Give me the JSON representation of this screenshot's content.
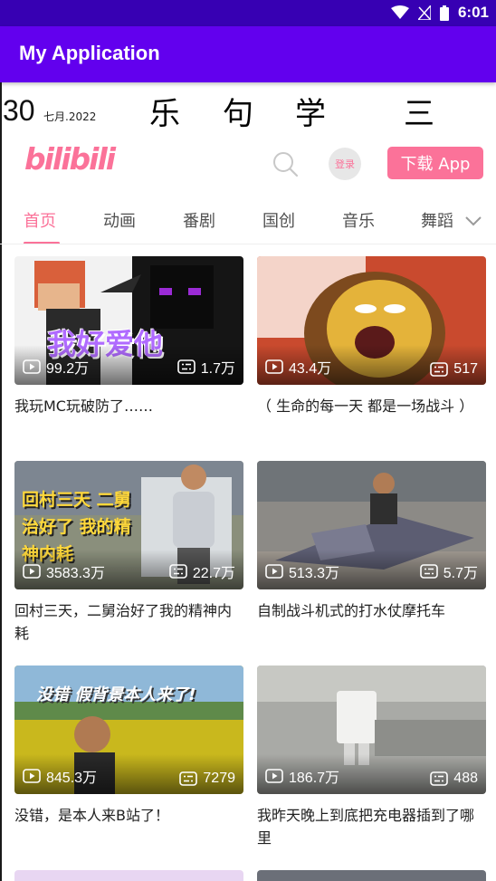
{
  "status_bar": {
    "time": "6:01"
  },
  "app_bar": {
    "title": "My Application"
  },
  "date": {
    "day": "30",
    "month_year": "七月.2022"
  },
  "word": {
    "chars": [
      "乐",
      "句",
      "学",
      "三"
    ]
  },
  "header": {
    "logo": "bilibili",
    "login_label": "登录",
    "download_label": "下载 App"
  },
  "tabs": [
    "首页",
    "动画",
    "番剧",
    "国创",
    "音乐",
    "舞蹈"
  ],
  "videos": [
    {
      "title": "我玩MC玩破防了……",
      "caption": "我好爱他",
      "views": "99.2万",
      "danmaku": "1.7万"
    },
    {
      "title": "（ 生命的每一天 都是一场战斗 ）",
      "caption": "",
      "views": "43.4万",
      "danmaku": "517"
    },
    {
      "title": "回村三天，二舅治好了我的精神内耗",
      "caption": "回村三天 二舅治好了 我的精神内耗",
      "views": "3583.3万",
      "danmaku": "22.7万"
    },
    {
      "title": "自制战斗机式的打水仗摩托车",
      "caption": "",
      "views": "513.3万",
      "danmaku": "5.7万"
    },
    {
      "title": "没错，是本人来B站了！",
      "caption": "没错 假背景本人来了!",
      "views": "845.3万",
      "danmaku": "7279"
    },
    {
      "title": "我昨天晚上到底把充电器插到了哪里",
      "caption": "",
      "views": "186.7万",
      "danmaku": "488"
    }
  ],
  "colors": {
    "status_bar": "#3700b3",
    "app_bar": "#6200ee",
    "brand_pink": "#fb7299"
  },
  "icons": [
    "wifi-icon",
    "signal-icon",
    "battery-icon",
    "search-icon",
    "chevron-down-icon",
    "play-icon",
    "danmaku-icon"
  ]
}
